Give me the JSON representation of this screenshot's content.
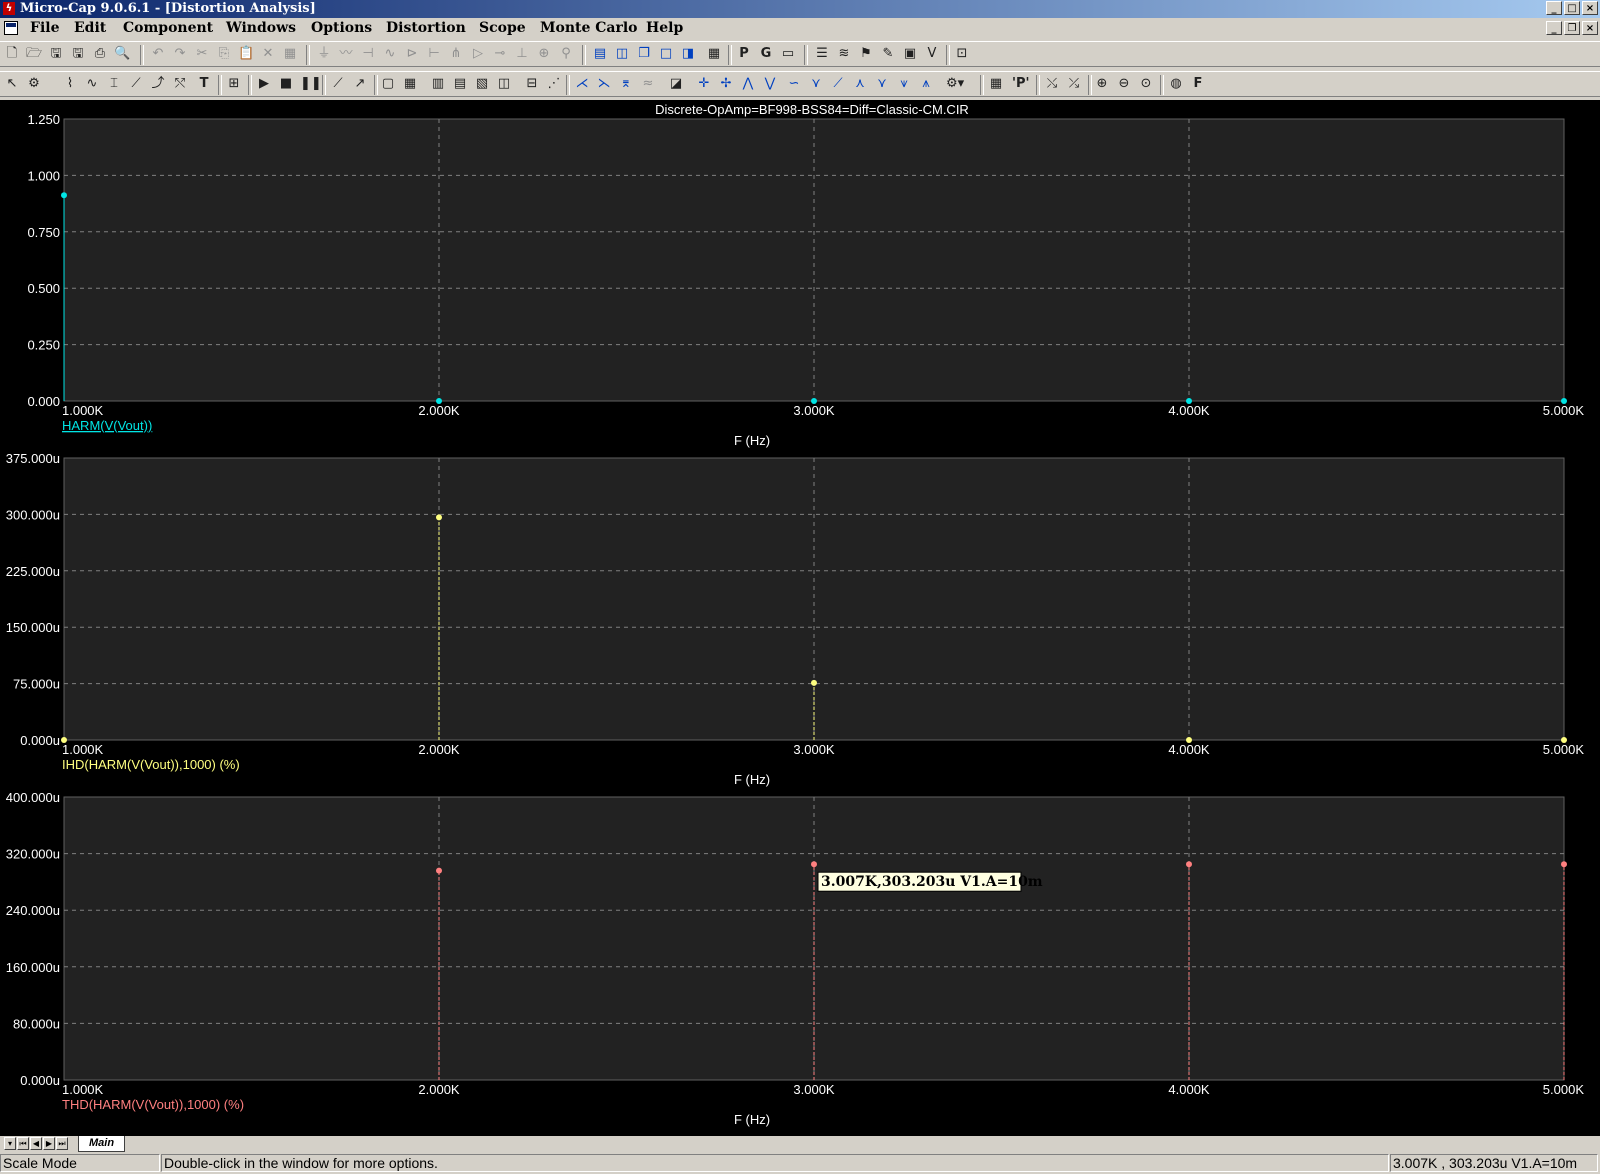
{
  "window": {
    "title": "Micro-Cap 9.0.6.1 - [Distortion Analysis]"
  },
  "menu": [
    "File",
    "Edit",
    "Component",
    "Windows",
    "Options",
    "Distortion",
    "Scope",
    "Monte Carlo",
    "Help"
  ],
  "plot_title": "Discrete-OpAmp=BF998-BSS84=Diff=Classic-CM.CIR",
  "colors": {
    "harm": "#00e5e5",
    "ihd": "#ffff80",
    "thd": "#ff8080",
    "grid": "#808080",
    "axis_text": "#ffffff",
    "panel": "#222222"
  },
  "chart_data": [
    {
      "type": "scatter",
      "title": "Discrete-OpAmp=BF998-BSS84=Diff=Classic-CM.CIR",
      "series": [
        {
          "name": "HARM(V(Vout))",
          "x": [
            1000,
            2000,
            3000,
            4000,
            5000
          ],
          "y": [
            0.912,
            0,
            0,
            0,
            0
          ]
        }
      ],
      "xlabel": "F (Hz)",
      "xticks": [
        "1.000K",
        "2.000K",
        "3.000K",
        "4.000K",
        "5.000K"
      ],
      "yticks": [
        "0.000",
        "0.250",
        "0.500",
        "0.750",
        "1.000",
        "1.250"
      ],
      "xlim": [
        1000,
        5000
      ],
      "ylim": [
        0,
        1.25
      ],
      "grid": true
    },
    {
      "type": "scatter",
      "series": [
        {
          "name": "IHD(HARM(V(Vout)),1000) (%)",
          "x": [
            1000,
            2000,
            3000,
            4000,
            5000
          ],
          "y": [
            0,
            0.000296,
            7.6e-05,
            0,
            0
          ]
        }
      ],
      "xlabel": "F (Hz)",
      "xticks": [
        "1.000K",
        "2.000K",
        "3.000K",
        "4.000K",
        "5.000K"
      ],
      "yticks": [
        "0.000u",
        "75.000u",
        "150.000u",
        "225.000u",
        "300.000u",
        "375.000u"
      ],
      "xlim": [
        1000,
        5000
      ],
      "ylim": [
        0,
        0.000375
      ],
      "grid": true
    },
    {
      "type": "scatter",
      "series": [
        {
          "name": "THD(HARM(V(Vout)),1000) (%)",
          "x": [
            2000,
            3000,
            4000,
            5000
          ],
          "y": [
            0.000296,
            0.000305,
            0.000305,
            0.000305
          ]
        }
      ],
      "xlabel": "F (Hz)",
      "xticks": [
        "1.000K",
        "2.000K",
        "3.000K",
        "4.000K",
        "5.000K"
      ],
      "yticks": [
        "0.000u",
        "80.000u",
        "160.000u",
        "240.000u",
        "320.000u",
        "400.000u"
      ],
      "xlim": [
        1000,
        5000
      ],
      "ylim": [
        0,
        0.0004
      ],
      "grid": true,
      "annotation": {
        "text": "3.007K,303.203u V1.A=10m",
        "x": 3000,
        "y": 0.000305
      }
    }
  ],
  "tab": {
    "label": "Main"
  },
  "status": {
    "mode": "Scale Mode",
    "hint": "Double-click in the window for more options.",
    "readout": "3.007K , 303.203u  V1.A=10m"
  }
}
